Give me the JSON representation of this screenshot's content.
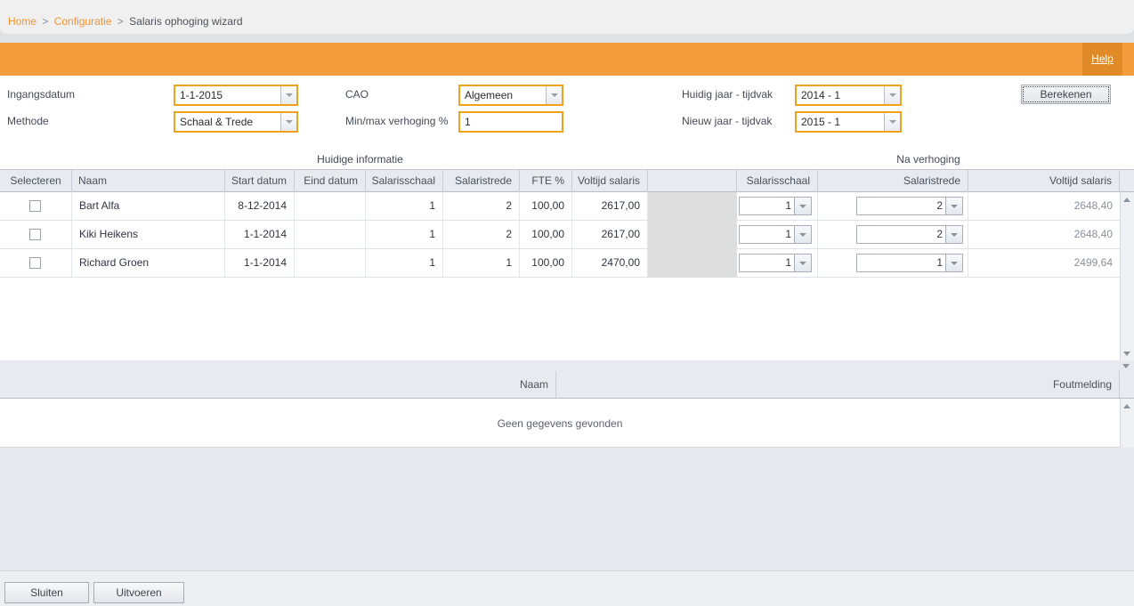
{
  "breadcrumb": {
    "home": "Home",
    "sep1": ">",
    "configuration": "Configuratie",
    "sep2": ">",
    "current": "Salaris ophoging wizard"
  },
  "toolbar": {
    "help_label": "Help",
    "help_bg": "#e08b28",
    "bar_bg": "#f59c3c"
  },
  "form": {
    "ingangsdatum_label": "Ingangsdatum",
    "ingangsdatum_value": "1-1-2015",
    "methode_label": "Methode",
    "methode_value": "Schaal & Trede",
    "cao_label": "CAO",
    "cao_value": "Algemeen",
    "minmax_label": "Min/max verhoging %",
    "minmax_value": "1",
    "huidig_jaar_label": "Huidig jaar - tijdvak",
    "huidig_jaar_value": "2014 - 1",
    "nieuw_jaar_label": "Nieuw jaar - tijdvak",
    "nieuw_jaar_value": "2015 - 1",
    "berekenen_label": "Berekenen",
    "field_border_color": "#f0a21f"
  },
  "grid": {
    "group_current": "Huidige informatie",
    "group_after": "Na verhoging",
    "headers": {
      "selecteren": "Selecteren",
      "naam": "Naam",
      "start_datum": "Start datum",
      "eind_datum": "Eind datum",
      "salarisschaal": "Salarisschaal",
      "salaristrede": "Salaristrede",
      "fte": "FTE %",
      "voltijd_salaris": "Voltijd salaris",
      "spacer": "",
      "new_salarisschaal": "Salarisschaal",
      "new_salaristrede": "Salaristrede",
      "new_voltijd_salaris": "Voltijd salaris"
    },
    "rows": [
      {
        "selected": false,
        "naam": "Bart Alfa",
        "start_datum": "8-12-2014",
        "eind_datum": "",
        "salarisschaal": "1",
        "salaristrede": "2",
        "fte": "100,00",
        "voltijd_salaris": "2617,00",
        "new_salarisschaal": "1",
        "new_salaristrede": "2",
        "new_voltijd_salaris": "2648,40"
      },
      {
        "selected": false,
        "naam": "Kiki Heikens",
        "start_datum": "1-1-2014",
        "eind_datum": "",
        "salarisschaal": "1",
        "salaristrede": "2",
        "fte": "100,00",
        "voltijd_salaris": "2617,00",
        "new_salarisschaal": "1",
        "new_salaristrede": "2",
        "new_voltijd_salaris": "2648,40"
      },
      {
        "selected": false,
        "naam": "Richard Groen",
        "start_datum": "1-1-2014",
        "eind_datum": "",
        "salarisschaal": "1",
        "salaristrede": "1",
        "fte": "100,00",
        "voltijd_salaris": "2470,00",
        "new_salarisschaal": "1",
        "new_salaristrede": "1",
        "new_voltijd_salaris": "2499,64"
      }
    ]
  },
  "error_grid": {
    "header_naam": "Naam",
    "header_foutmelding": "Foutmelding",
    "empty_message": "Geen gegevens gevonden"
  },
  "footer": {
    "sluiten_label": "Sluiten",
    "uitvoeren_label": "Uitvoeren"
  }
}
